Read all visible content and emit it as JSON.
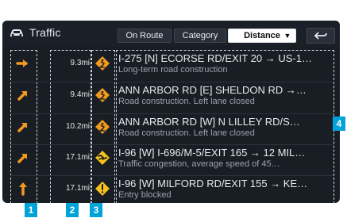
{
  "window": {
    "title": "Traffic"
  },
  "tabs": [
    {
      "label": "On Route"
    },
    {
      "label": "Category"
    }
  ],
  "sort": {
    "selected": "Distance"
  },
  "list": [
    {
      "distance": "9.3mi",
      "title": "I-275 [N] ECORSE RD/EXIT 20 → US-1…",
      "subtitle": "Long-term road construction"
    },
    {
      "distance": "9.4mi",
      "title": "ANN ARBOR RD [E] SHELDON RD →…",
      "subtitle": "Road construction. Left lane closed"
    },
    {
      "distance": "10.2mi",
      "title": "ANN ARBOR RD [W] N LILLEY RD/S…",
      "subtitle": "Road construction. Left lane closed"
    },
    {
      "distance": "17.1mi",
      "title": "I-96 [W] I-696/M-5/EXIT 165 → 12 MIL…",
      "subtitle": "Traffic congestion, average speed of 45…"
    },
    {
      "distance": "17.1mi",
      "title": "I-96 [W] MILFORD RD/EXIT 155 → KE…",
      "subtitle": "Entry blocked"
    }
  ],
  "labels": {
    "col1": "1",
    "col2": "2",
    "col3": "3",
    "col4": "4"
  },
  "colors": {
    "background": "#191d24",
    "accent_orange": "#f39a1e",
    "accent_yellow": "#f4c21b",
    "label_blue": "#00a3d8"
  },
  "icons": {
    "car": "car-icon",
    "back": "back-arrow-icon",
    "direction": [
      "arrow-right-icon",
      "arrow-up-right-icon",
      "arrow-up-right-icon",
      "arrow-up-right-icon",
      "arrow-up-icon"
    ],
    "incident": [
      "road-work-icon",
      "road-work-icon",
      "road-work-icon",
      "congestion-icon",
      "warning-icon"
    ]
  }
}
